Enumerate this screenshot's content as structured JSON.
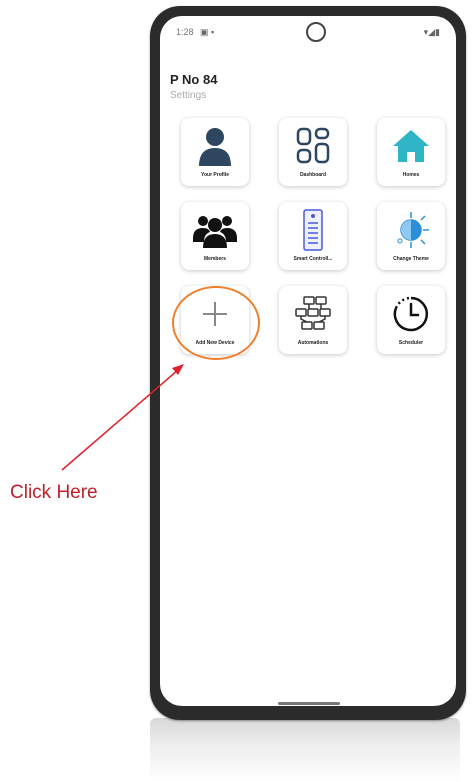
{
  "status_bar": {
    "time": "1:28",
    "left_icons": "▣ ▪",
    "right_icons": "▾◢▮"
  },
  "header": {
    "title": "P No 84",
    "subtitle": "Settings"
  },
  "tiles": [
    {
      "label": "Your Profile",
      "icon": "user-icon"
    },
    {
      "label": "Dashboard",
      "icon": "dashboard-icon"
    },
    {
      "label": "Homes",
      "icon": "home-icon"
    },
    {
      "label": "Members",
      "icon": "members-icon"
    },
    {
      "label": "Smart Controll...",
      "icon": "smart-controller-icon"
    },
    {
      "label": "Change Theme",
      "icon": "theme-icon"
    },
    {
      "label": "Add New Device",
      "icon": "plus-icon"
    },
    {
      "label": "Automations",
      "icon": "automations-icon"
    },
    {
      "label": "Scheduler",
      "icon": "scheduler-icon"
    }
  ],
  "annotation": {
    "text": "Click Here",
    "color": "#c0202a",
    "circle_color": "#ee7f2d"
  },
  "colors": {
    "profile_icon": "#2e4660",
    "home_icon": "#2fb5c6",
    "theme_icon": "#2a8fd8"
  }
}
